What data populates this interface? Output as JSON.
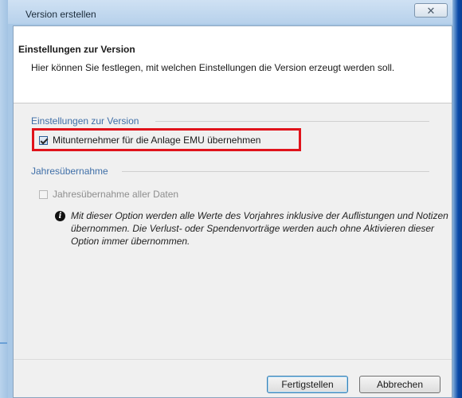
{
  "window": {
    "title": "Version erstellen",
    "close_glyph": "✕"
  },
  "header": {
    "title": "Einstellungen zur Version",
    "description": "Hier können Sie festlegen, mit welchen Einstellungen die Version erzeugt werden soll."
  },
  "group_version": {
    "label": "Einstellungen zur Version",
    "checkbox_label": "Mitunternehmer für die Anlage EMU übernehmen",
    "checked": true
  },
  "group_year": {
    "label": "Jahresübernahme",
    "checkbox_label": "Jahresübernahme aller Daten",
    "checked": false,
    "enabled": false
  },
  "info": {
    "icon": "info-icon",
    "text": "Mit dieser Option werden alle Werte des Vorjahres inklusive der Auflistungen und Notizen übernommen. Die Verlust- oder Spendenvorträge werden auch ohne Aktivieren dieser Option immer übernommen."
  },
  "buttons": {
    "finish": "Fertigstellen",
    "cancel": "Abbrechen"
  },
  "colors": {
    "highlight": "#e0131b",
    "group_label": "#3f6fa8"
  }
}
